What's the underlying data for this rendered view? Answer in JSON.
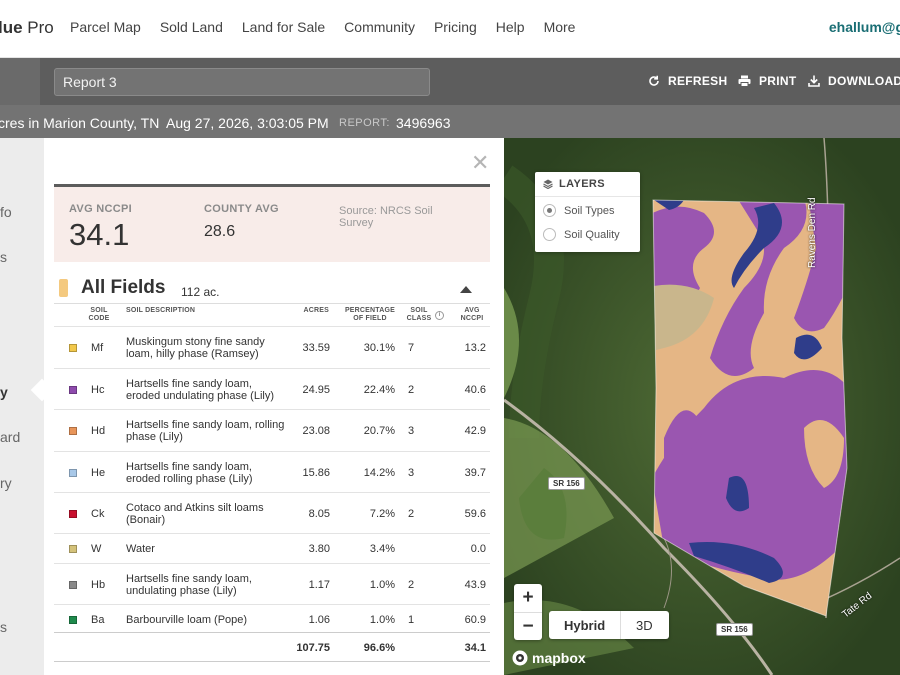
{
  "brand": {
    "part1": "lue",
    "part2": " Pro"
  },
  "nav": [
    "Parcel Map",
    "Sold Land",
    "Land for Sale",
    "Community",
    "Pricing",
    "Help",
    "More"
  ],
  "user": "ehallum@g",
  "toolbar": {
    "report_name": "Report 3",
    "refresh": "REFRESH",
    "print": "PRINT",
    "download": "DOWNLOAD"
  },
  "info": {
    "location": "cres in Marion County, TN",
    "datetime": "Aug 27, 2026, 3:03:05 PM",
    "report_label": "REPORT:",
    "report_id": "3496963"
  },
  "sidebar": [
    "fo",
    "s",
    "y",
    "ard",
    "ry",
    "s"
  ],
  "summary": {
    "avg_label": "AVG NCCPI",
    "avg_value": "34.1",
    "county_label": "COUNTY AVG",
    "county_value": "28.6",
    "source": "Source: NRCS Soil Survey"
  },
  "field": {
    "title": "All Fields",
    "acres": "112 ac."
  },
  "columns": {
    "code": "SOIL CODE",
    "desc": "SOIL DESCRIPTION",
    "acres": "ACRES",
    "pct": "PERCENTAGE OF FIELD",
    "cls": "SOIL CLASS",
    "avg": "AVG NCCPI"
  },
  "soils": [
    {
      "color": "#f2c84b",
      "code": "Mf",
      "desc": "Muskingum stony fine sandy loam, hilly phase (Ramsey)",
      "acres": "33.59",
      "pct": "30.1%",
      "cls": "7",
      "avg": "13.2"
    },
    {
      "color": "#8e4bad",
      "code": "Hc",
      "desc": "Hartsells fine sandy loam, eroded undulating phase (Lily)",
      "acres": "24.95",
      "pct": "22.4%",
      "cls": "2",
      "avg": "40.6"
    },
    {
      "color": "#e8955a",
      "code": "Hd",
      "desc": "Hartsells fine sandy loam, rolling phase (Lily)",
      "acres": "23.08",
      "pct": "20.7%",
      "cls": "3",
      "avg": "42.9"
    },
    {
      "color": "#a8c8e8",
      "code": "He",
      "desc": "Hartsells fine sandy loam, eroded rolling phase (Lily)",
      "acres": "15.86",
      "pct": "14.2%",
      "cls": "3",
      "avg": "39.7"
    },
    {
      "color": "#c8102e",
      "code": "Ck",
      "desc": "Cotaco and Atkins silt loams (Bonair)",
      "acres": "8.05",
      "pct": "7.2%",
      "cls": "2",
      "avg": "59.6"
    },
    {
      "color": "#d4c27a",
      "code": "W",
      "desc": "Water",
      "acres": "3.80",
      "pct": "3.4%",
      "cls": "",
      "avg": "0.0"
    },
    {
      "color": "#8a8a8a",
      "code": "Hb",
      "desc": "Hartsells fine sandy loam, undulating phase (Lily)",
      "acres": "1.17",
      "pct": "1.0%",
      "cls": "2",
      "avg": "43.9"
    },
    {
      "color": "#1f8a4c",
      "code": "Ba",
      "desc": "Barbourville loam (Pope)",
      "acres": "1.06",
      "pct": "1.0%",
      "cls": "1",
      "avg": "60.9"
    }
  ],
  "totals": {
    "acres": "107.75",
    "pct": "96.6%",
    "avg": "34.1"
  },
  "map": {
    "layers_title": "LAYERS",
    "layer_options": [
      "Soil Types",
      "Soil Quality"
    ],
    "selected_layer": "Soil Types",
    "zoom_in": "+",
    "zoom_out": "−",
    "map_types": [
      "Hybrid",
      "3D"
    ],
    "selected_map_type": "Hybrid",
    "attribution": "mapbox",
    "road_labels": [
      "SR 156",
      "SR 156"
    ],
    "street_labels": [
      "Ravens Den Rd",
      "Tate Rd"
    ]
  }
}
